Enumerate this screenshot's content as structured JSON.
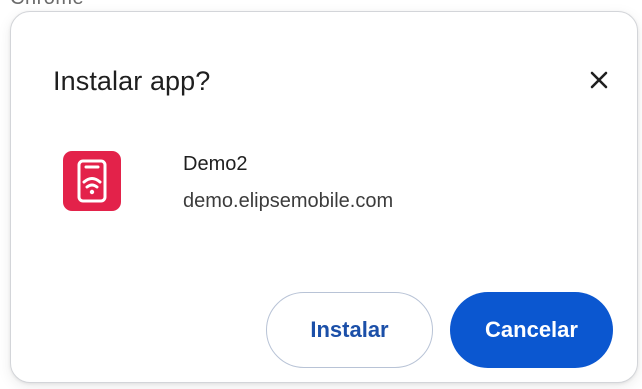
{
  "clipped_header": "Chrome",
  "dialog": {
    "title": "Instalar app?",
    "close_icon": "close-icon",
    "app": {
      "icon": "phone-wifi-icon",
      "name": "Demo2",
      "url": "demo.elipsemobile.com",
      "icon_color": "#e3224a"
    },
    "buttons": {
      "install_label": "Instalar",
      "cancel_label": "Cancelar"
    },
    "accent_color": "#0b57d0"
  }
}
